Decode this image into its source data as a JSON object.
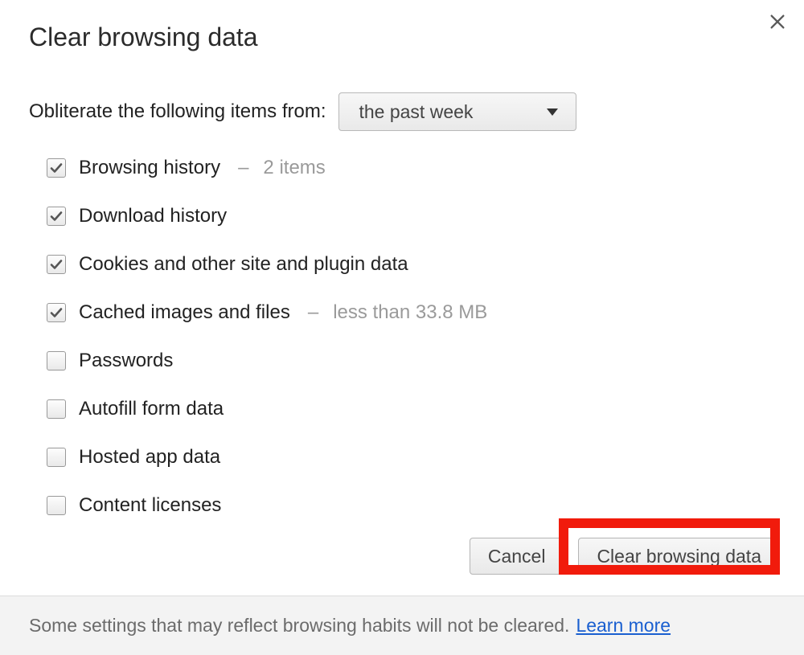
{
  "dialog": {
    "title": "Clear browsing data",
    "prompt_label": "Obliterate the following items from:",
    "time_range_selected": "the past week",
    "items": [
      {
        "label": "Browsing history",
        "checked": true,
        "suffix": "2 items"
      },
      {
        "label": "Download history",
        "checked": true,
        "suffix": ""
      },
      {
        "label": "Cookies and other site and plugin data",
        "checked": true,
        "suffix": ""
      },
      {
        "label": "Cached images and files",
        "checked": true,
        "suffix": "less than 33.8 MB"
      },
      {
        "label": "Passwords",
        "checked": false,
        "suffix": ""
      },
      {
        "label": "Autofill form data",
        "checked": false,
        "suffix": ""
      },
      {
        "label": "Hosted app data",
        "checked": false,
        "suffix": ""
      },
      {
        "label": "Content licenses",
        "checked": false,
        "suffix": ""
      }
    ],
    "buttons": {
      "cancel": "Cancel",
      "confirm": "Clear browsing data"
    },
    "footer_text": "Some settings that may reflect browsing habits will not be cleared.",
    "footer_link": "Learn more",
    "highlight_color": "#f11b0c"
  }
}
